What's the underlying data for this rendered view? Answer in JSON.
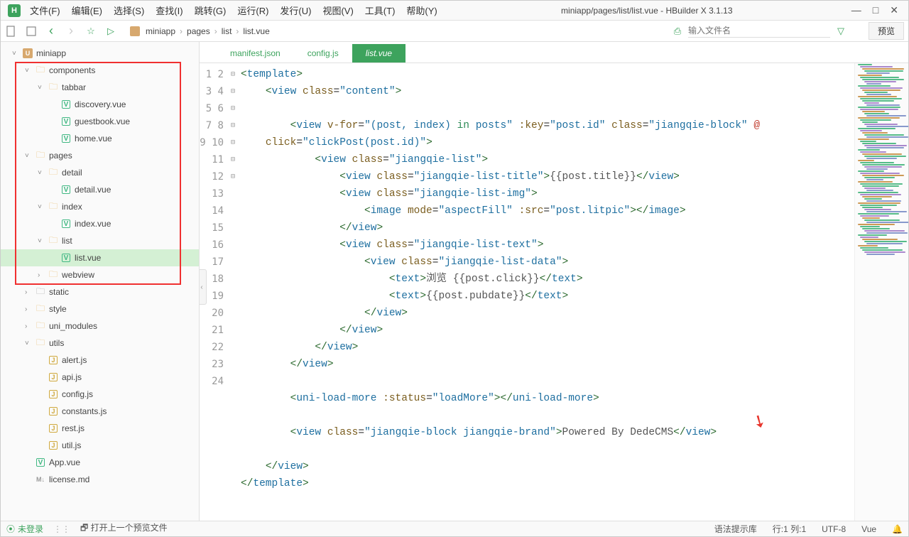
{
  "menus": [
    "文件(F)",
    "编辑(E)",
    "选择(S)",
    "查找(I)",
    "跳转(G)",
    "运行(R)",
    "发行(U)",
    "视图(V)",
    "工具(T)",
    "帮助(Y)"
  ],
  "window_title": "miniapp/pages/list/list.vue - HBuilder X 3.1.13",
  "breadcrumb": [
    "miniapp",
    "pages",
    "list",
    "list.vue"
  ],
  "search_placeholder": "输入文件名",
  "preview_label": "预览",
  "tabs": [
    {
      "label": "manifest.json",
      "active": false
    },
    {
      "label": "config.js",
      "active": false
    },
    {
      "label": "list.vue",
      "active": true
    }
  ],
  "tree": {
    "root": "miniapp",
    "nodes": [
      {
        "depth": 1,
        "chev": "v",
        "icon": "folder",
        "label": "components"
      },
      {
        "depth": 2,
        "chev": "v",
        "icon": "folder",
        "label": "tabbar"
      },
      {
        "depth": 3,
        "chev": "",
        "icon": "vue",
        "label": "discovery.vue"
      },
      {
        "depth": 3,
        "chev": "",
        "icon": "vue",
        "label": "guestbook.vue"
      },
      {
        "depth": 3,
        "chev": "",
        "icon": "vue",
        "label": "home.vue"
      },
      {
        "depth": 1,
        "chev": "v",
        "icon": "folder",
        "label": "pages"
      },
      {
        "depth": 2,
        "chev": "v",
        "icon": "folder",
        "label": "detail"
      },
      {
        "depth": 3,
        "chev": "",
        "icon": "vue",
        "label": "detail.vue"
      },
      {
        "depth": 2,
        "chev": "v",
        "icon": "folder",
        "label": "index"
      },
      {
        "depth": 3,
        "chev": "",
        "icon": "vue",
        "label": "index.vue"
      },
      {
        "depth": 2,
        "chev": "v",
        "icon": "folder",
        "label": "list"
      },
      {
        "depth": 3,
        "chev": "",
        "icon": "vue",
        "label": "list.vue",
        "selected": true
      },
      {
        "depth": 2,
        "chev": ">",
        "icon": "folder",
        "label": "webview"
      },
      {
        "depth": 1,
        "chev": ">",
        "icon": "folder-dark",
        "label": "static"
      },
      {
        "depth": 1,
        "chev": ">",
        "icon": "folder",
        "label": "style"
      },
      {
        "depth": 1,
        "chev": ">",
        "icon": "folder",
        "label": "uni_modules"
      },
      {
        "depth": 1,
        "chev": "v",
        "icon": "folder",
        "label": "utils"
      },
      {
        "depth": 2,
        "chev": "",
        "icon": "js",
        "label": "alert.js"
      },
      {
        "depth": 2,
        "chev": "",
        "icon": "js",
        "label": "api.js"
      },
      {
        "depth": 2,
        "chev": "",
        "icon": "js",
        "label": "config.js"
      },
      {
        "depth": 2,
        "chev": "",
        "icon": "js",
        "label": "constants.js"
      },
      {
        "depth": 2,
        "chev": "",
        "icon": "js",
        "label": "rest.js"
      },
      {
        "depth": 2,
        "chev": "",
        "icon": "js",
        "label": "util.js"
      },
      {
        "depth": 1,
        "chev": "",
        "icon": "vue",
        "label": "App.vue"
      },
      {
        "depth": 1,
        "chev": "",
        "icon": "md",
        "label": "license.md"
      }
    ]
  },
  "code_lines": [
    {
      "n": 1,
      "f": "⊟",
      "html": "<span class='t-punct'>&lt;</span><span class='t-tag'>template</span><span class='t-punct'>&gt;</span>"
    },
    {
      "n": 2,
      "f": "⊟",
      "html": "    <span class='t-punct'>&lt;</span><span class='t-tag'>view</span> <span class='t-attr'>class</span>=<span class='t-val'>\"content\"</span><span class='t-punct'>&gt;</span>"
    },
    {
      "n": 3,
      "f": "",
      "html": ""
    },
    {
      "n": 4,
      "f": "⊟",
      "html": "        <span class='t-punct'>&lt;</span><span class='t-tag'>view</span> <span class='t-attr'>v-for</span>=<span class='t-val'>\"(post, index) <span class='t-key'>in</span> posts\"</span> <span class='t-attr'>:key</span>=<span class='t-val'>\"post.id\"</span> <span class='t-attr'>class</span>=<span class='t-val'>\"jiangqie-block\"</span> <span class='t-op'>@</span>"
    },
    {
      "n": 0,
      "f": "",
      "html": "    <span class='t-attr'>click</span>=<span class='t-val'>\"clickPost(post.id)\"</span><span class='t-punct'>&gt;</span>"
    },
    {
      "n": 5,
      "f": "⊟",
      "html": "            <span class='t-punct'>&lt;</span><span class='t-tag'>view</span> <span class='t-attr'>class</span>=<span class='t-val'>\"jiangqie-list\"</span><span class='t-punct'>&gt;</span>"
    },
    {
      "n": 6,
      "f": "",
      "html": "                <span class='t-punct'>&lt;</span><span class='t-tag'>view</span> <span class='t-attr'>class</span>=<span class='t-val'>\"jiangqie-list-title\"</span><span class='t-punct'>&gt;</span><span class='t-txt'>{{post.title}}</span><span class='t-punct'>&lt;/</span><span class='t-tag'>view</span><span class='t-punct'>&gt;</span>"
    },
    {
      "n": 7,
      "f": "⊟",
      "html": "                <span class='t-punct'>&lt;</span><span class='t-tag'>view</span> <span class='t-attr'>class</span>=<span class='t-val'>\"jiangqie-list-img\"</span><span class='t-punct'>&gt;</span>"
    },
    {
      "n": 8,
      "f": "",
      "html": "                    <span class='t-punct'>&lt;</span><span class='t-tag'>image</span> <span class='t-attr'>mode</span>=<span class='t-val'>\"aspectFill\"</span> <span class='t-attr'>:src</span>=<span class='t-val'>\"post.litpic\"</span><span class='t-punct'>&gt;&lt;/</span><span class='t-tag'>image</span><span class='t-punct'>&gt;</span>"
    },
    {
      "n": 9,
      "f": "",
      "html": "                <span class='t-punct'>&lt;/</span><span class='t-tag'>view</span><span class='t-punct'>&gt;</span>"
    },
    {
      "n": 10,
      "f": "⊟",
      "html": "                <span class='t-punct'>&lt;</span><span class='t-tag'>view</span> <span class='t-attr'>class</span>=<span class='t-val'>\"jiangqie-list-text\"</span><span class='t-punct'>&gt;</span>"
    },
    {
      "n": 11,
      "f": "⊟",
      "html": "                    <span class='t-punct'>&lt;</span><span class='t-tag'>view</span> <span class='t-attr'>class</span>=<span class='t-val'>\"jiangqie-list-data\"</span><span class='t-punct'>&gt;</span>"
    },
    {
      "n": 12,
      "f": "",
      "html": "                        <span class='t-punct'>&lt;</span><span class='t-tag'>text</span><span class='t-punct'>&gt;</span><span class='t-txt'>浏览 {{post.click}}</span><span class='t-punct'>&lt;/</span><span class='t-tag'>text</span><span class='t-punct'>&gt;</span>"
    },
    {
      "n": 13,
      "f": "",
      "html": "                        <span class='t-punct'>&lt;</span><span class='t-tag'>text</span><span class='t-punct'>&gt;</span><span class='t-txt'>{{post.pubdate}}</span><span class='t-punct'>&lt;/</span><span class='t-tag'>text</span><span class='t-punct'>&gt;</span>"
    },
    {
      "n": 14,
      "f": "",
      "html": "                    <span class='t-punct'>&lt;/</span><span class='t-tag'>view</span><span class='t-punct'>&gt;</span>"
    },
    {
      "n": 15,
      "f": "",
      "html": "                <span class='t-punct'>&lt;/</span><span class='t-tag'>view</span><span class='t-punct'>&gt;</span>"
    },
    {
      "n": 16,
      "f": "",
      "html": "            <span class='t-punct'>&lt;/</span><span class='t-tag'>view</span><span class='t-punct'>&gt;</span>"
    },
    {
      "n": 17,
      "f": "",
      "html": "        <span class='t-punct'>&lt;/</span><span class='t-tag'>view</span><span class='t-punct'>&gt;</span>"
    },
    {
      "n": 18,
      "f": "",
      "html": ""
    },
    {
      "n": 19,
      "f": "",
      "html": "        <span class='t-punct'>&lt;</span><span class='t-tag'>uni-load-more</span> <span class='t-attr'>:status</span>=<span class='t-val'>\"loadMore\"</span><span class='t-punct'>&gt;&lt;/</span><span class='t-tag'>uni-load-more</span><span class='t-punct'>&gt;</span>"
    },
    {
      "n": 20,
      "f": "",
      "html": ""
    },
    {
      "n": 21,
      "f": "",
      "html": "        <span class='t-punct'>&lt;</span><span class='t-tag'>view</span> <span class='t-attr'>class</span>=<span class='t-val'>\"jiangqie-block jiangqie-brand\"</span><span class='t-punct'>&gt;</span><span class='t-txt'>Powered By DedeCMS</span><span class='t-punct'>&lt;/</span><span class='t-tag'>view</span><span class='t-punct'>&gt;</span>"
    },
    {
      "n": 22,
      "f": "",
      "html": ""
    },
    {
      "n": 23,
      "f": "",
      "html": "    <span class='t-punct'>&lt;/</span><span class='t-tag'>view</span><span class='t-punct'>&gt;</span>"
    },
    {
      "n": 24,
      "f": "",
      "html": "<span class='t-punct'>&lt;/</span><span class='t-tag'>template</span><span class='t-punct'>&gt;</span>"
    }
  ],
  "status": {
    "login": "未登录",
    "hint": "打开上一个预览文件",
    "syntax": "语法提示库",
    "pos": "行:1  列:1",
    "encoding": "UTF-8",
    "lang": "Vue"
  }
}
